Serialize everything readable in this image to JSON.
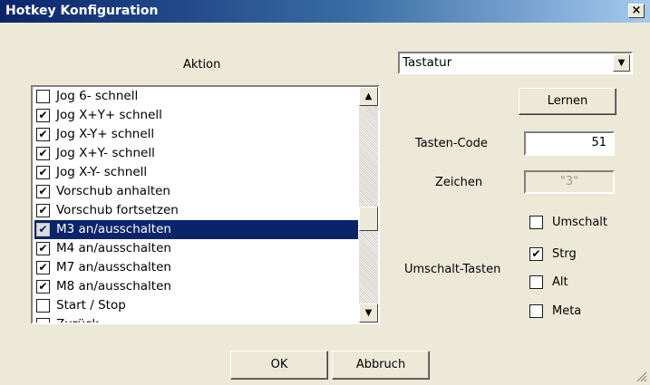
{
  "window": {
    "title": "Hotkey Konfiguration",
    "close": "×"
  },
  "action_header": "Aktion",
  "actions": [
    {
      "label": "Jog 6- schnell",
      "checked": false,
      "selected": false
    },
    {
      "label": "Jog X+Y+ schnell",
      "checked": true,
      "selected": false
    },
    {
      "label": "Jog X-Y+ schnell",
      "checked": true,
      "selected": false
    },
    {
      "label": "Jog X+Y- schnell",
      "checked": true,
      "selected": false
    },
    {
      "label": "Jog X-Y- schnell",
      "checked": true,
      "selected": false
    },
    {
      "label": "Vorschub anhalten",
      "checked": true,
      "selected": false
    },
    {
      "label": "Vorschub fortsetzen",
      "checked": true,
      "selected": false
    },
    {
      "label": "M3 an/ausschalten",
      "checked": true,
      "selected": true
    },
    {
      "label": "M4 an/ausschalten",
      "checked": true,
      "selected": false
    },
    {
      "label": "M7 an/ausschalten",
      "checked": true,
      "selected": false
    },
    {
      "label": "M8 an/ausschalten",
      "checked": true,
      "selected": false
    },
    {
      "label": "Start / Stop",
      "checked": false,
      "selected": false
    },
    {
      "label": "Zurück...",
      "checked": false,
      "selected": false
    }
  ],
  "device_select": {
    "value": "Tastatur"
  },
  "learn_button": "Lernen",
  "key_code": {
    "label": "Tasten-Code",
    "value": "51"
  },
  "char": {
    "label": "Zeichen",
    "value": "\"3\""
  },
  "modifiers": {
    "label": "Umschalt-Tasten",
    "items": [
      {
        "label": "Umschalt",
        "checked": false
      },
      {
        "label": "Strg",
        "checked": true
      },
      {
        "label": "Alt",
        "checked": false
      },
      {
        "label": "Meta",
        "checked": false
      }
    ]
  },
  "ok_button": "OK",
  "cancel_button": "Abbruch",
  "glyphs": {
    "check": "✔",
    "up": "▲",
    "down": "▼"
  }
}
